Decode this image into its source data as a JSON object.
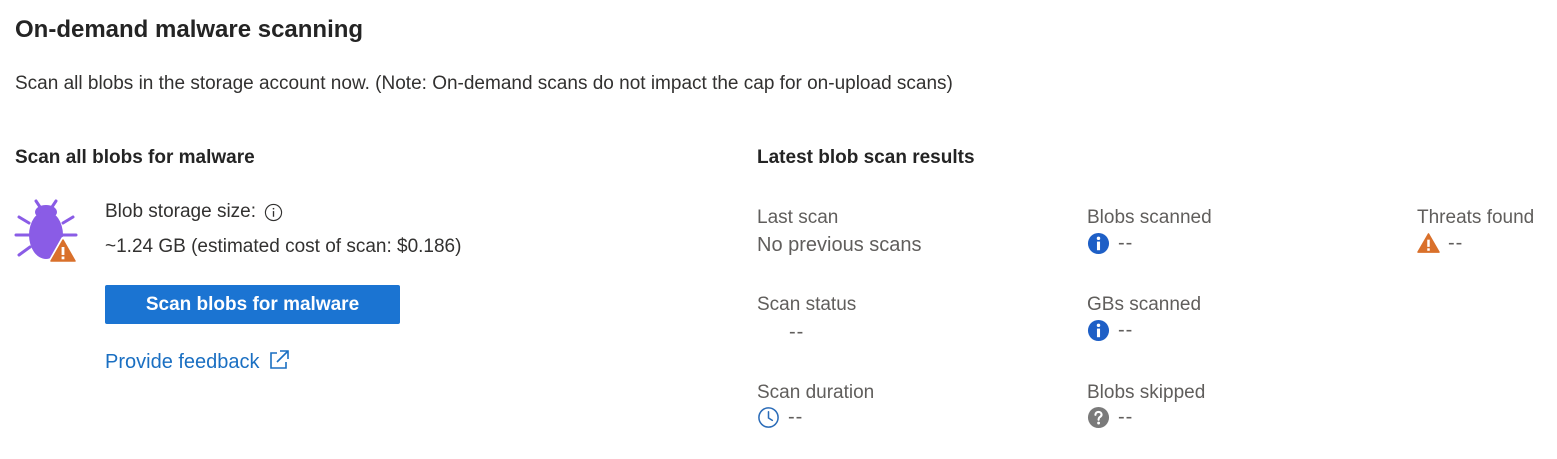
{
  "page": {
    "title": "On-demand malware scanning",
    "subtitle": "Scan all blobs in the storage account now. (Note: On-demand scans do not impact the cap for on-upload scans)"
  },
  "left": {
    "heading": "Scan all blobs for malware",
    "icon": "bug-warning-icon",
    "storage_label": "Blob storage size:",
    "storage_value": "~1.24 GB (estimated cost of scan: $0.186)",
    "scan_button": "Scan blobs for malware",
    "feedback_link": "Provide feedback"
  },
  "results": {
    "heading": "Latest blob scan results",
    "last_scan": {
      "label": "Last scan",
      "value": "No previous scans"
    },
    "blobs_scanned": {
      "label": "Blobs scanned",
      "value": "--",
      "icon": "info-icon"
    },
    "threats_found": {
      "label": "Threats found",
      "value": "--",
      "icon": "warning-icon"
    },
    "scan_status": {
      "label": "Scan status",
      "value": "--"
    },
    "gbs_scanned": {
      "label": "GBs scanned",
      "value": "--",
      "icon": "info-icon"
    },
    "scan_duration": {
      "label": "Scan duration",
      "value": "--",
      "icon": "clock-icon"
    },
    "blobs_skipped": {
      "label": "Blobs skipped",
      "value": "--",
      "icon": "help-icon"
    }
  },
  "colors": {
    "accent": "#1b74d2",
    "link": "#1a6fc2",
    "bug": "#8a5ce6",
    "warning": "#d9702b",
    "info": "#1e5fc6",
    "help": "#7a7a7a"
  }
}
